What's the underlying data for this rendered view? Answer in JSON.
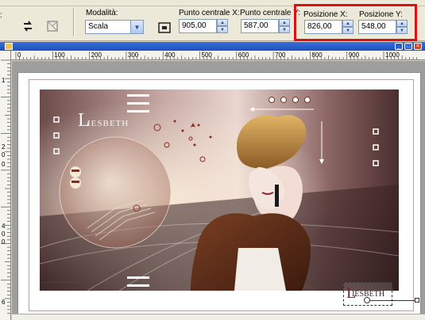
{
  "toolbar": {
    "mode_label": "Modalità:",
    "mode_value": "Scala",
    "center_x_label": "Punto centrale X:",
    "center_x_value": "905,00",
    "center_y_label": "Punto centrale Y:",
    "center_y_value": "587,00",
    "pos_x_label": "Posizione X:",
    "pos_x_value": "826,00",
    "pos_y_label": "Posizione Y:",
    "pos_y_value": "548,00",
    "left_colon": ":"
  },
  "ruler": {
    "h_labels": [
      "0",
      "100",
      "200",
      "300",
      "400",
      "500",
      "600",
      "700",
      "800",
      "900",
      "1000"
    ],
    "v_labels": [
      "1",
      "2",
      "0",
      "0",
      "4",
      "0",
      "0",
      "6"
    ]
  },
  "artwork": {
    "signature_text": "LIESBETH",
    "stamp_text": "IESBETH"
  },
  "colors": {
    "highlight": "#e01010",
    "titlebar": "#2a5fd0"
  }
}
